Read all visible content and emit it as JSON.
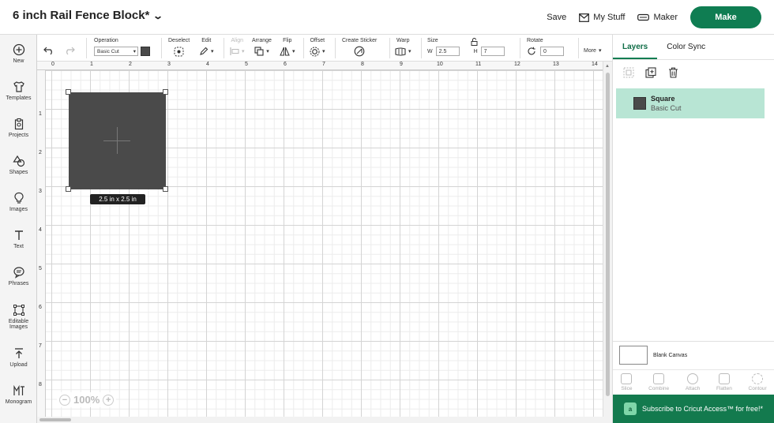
{
  "header": {
    "project_title": "6 inch Rail Fence Block*",
    "save_label": "Save",
    "mystuff_label": "My Stuff",
    "maker_label": "Maker",
    "make_label": "Make"
  },
  "sidebar": {
    "items": [
      {
        "label": "New",
        "icon": "plus-circle-icon"
      },
      {
        "label": "Templates",
        "icon": "shirt-icon"
      },
      {
        "label": "Projects",
        "icon": "clipboard-icon"
      },
      {
        "label": "Shapes",
        "icon": "shapes-icon"
      },
      {
        "label": "Images",
        "icon": "bulb-icon"
      },
      {
        "label": "Text",
        "icon": "text-icon"
      },
      {
        "label": "Phrases",
        "icon": "speech-icon"
      },
      {
        "label": "Editable Images",
        "icon": "edit-image-icon"
      },
      {
        "label": "Upload",
        "icon": "upload-icon"
      },
      {
        "label": "Monogram",
        "icon": "monogram-icon"
      }
    ]
  },
  "toolbar": {
    "operation_label": "Operation",
    "operation_value": "Basic Cut",
    "deselect_label": "Deselect",
    "edit_label": "Edit",
    "align_label": "Align",
    "arrange_label": "Arrange",
    "flip_label": "Flip",
    "offset_label": "Offset",
    "sticker_label": "Create Sticker",
    "warp_label": "Warp",
    "size_label": "Size",
    "w_label": "W",
    "w_value": "2.5",
    "h_label": "H",
    "h_value": "7",
    "rotate_label": "Rotate",
    "rotate_value": "0",
    "more_label": "More"
  },
  "canvas": {
    "ruler_top": [
      "0",
      "1",
      "2",
      "3",
      "4",
      "5",
      "6",
      "7",
      "8",
      "9",
      "10",
      "11",
      "12",
      "13",
      "14"
    ],
    "ruler_left": [
      "1",
      "2",
      "3",
      "4",
      "5",
      "6",
      "7",
      "8"
    ],
    "dimension_label": "2.5  in x 2.5  in",
    "zoom_value": "100%"
  },
  "panel": {
    "tab_layers": "Layers",
    "tab_colorsync": "Color Sync",
    "layer_name": "Square",
    "layer_op": "Basic Cut",
    "blank_canvas": "Blank Canvas",
    "actions": [
      "Slice",
      "Combine",
      "Attach",
      "Flatten",
      "Contour"
    ],
    "promo_text": "Subscribe to Cricut Access™ for free!*",
    "promo_badge": "a"
  },
  "colors": {
    "accent": "#0f7d52",
    "layer_selected": "#b8e5d4",
    "shape_fill": "#4a4a4a"
  }
}
